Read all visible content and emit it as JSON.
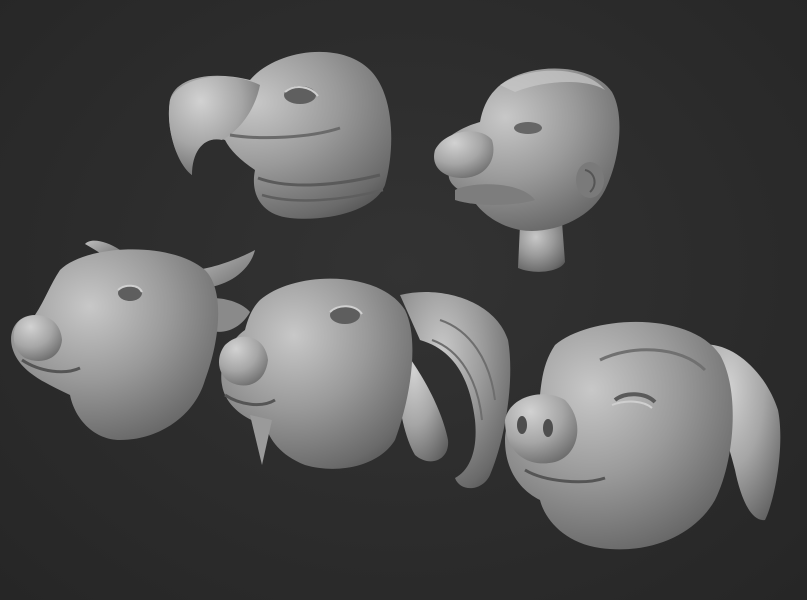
{
  "scene": {
    "background_color": "#2c2c2c",
    "clay_color": "#8f8f8f",
    "clay_highlight": "#c4c4c4",
    "clay_shadow": "#4a4a4a",
    "sculpts": [
      {
        "id": "vulture",
        "icon": "vulture-head-sculpt"
      },
      {
        "id": "human",
        "icon": "human-head-sculpt"
      },
      {
        "id": "bull",
        "icon": "bull-head-sculpt"
      },
      {
        "id": "ram",
        "icon": "ram-head-sculpt"
      },
      {
        "id": "pig",
        "icon": "pig-head-sculpt"
      }
    ]
  }
}
